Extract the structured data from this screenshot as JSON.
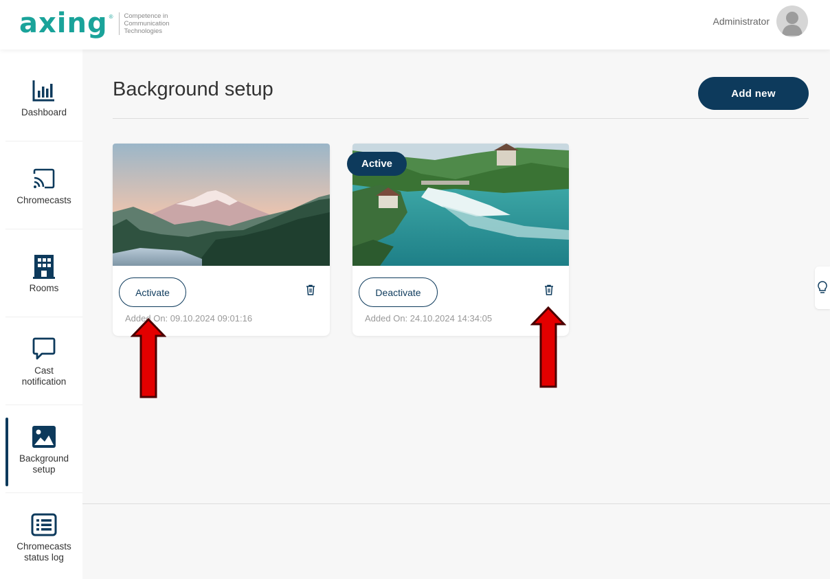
{
  "header": {
    "logo_word": "axing",
    "logo_reg": "®",
    "logo_tagline": [
      "Competence in",
      "Communication",
      "Technologies"
    ],
    "user_name": "Administrator"
  },
  "sidebar": {
    "items": [
      {
        "label": "Dashboard",
        "icon": "bar-chart-icon"
      },
      {
        "label": "Chromecasts",
        "icon": "cast-icon"
      },
      {
        "label": "Rooms",
        "icon": "building-icon"
      },
      {
        "label": "Cast notification",
        "icon": "speech-bubble-icon"
      },
      {
        "label": "Background setup",
        "icon": "image-icon",
        "active": true
      },
      {
        "label": "Chromecasts status log",
        "icon": "list-icon"
      }
    ]
  },
  "main": {
    "title": "Background setup",
    "add_button": "Add new",
    "cards": [
      {
        "button": "Activate",
        "added_on": "Added On: 09.10.2024 09:01:16",
        "image": "mountain-landscape",
        "active": false
      },
      {
        "button": "Deactivate",
        "added_on": "Added On: 24.10.2024 14:34:05",
        "image": "waterfall-landscape",
        "active": true,
        "badge": "Active"
      }
    ]
  },
  "colors": {
    "brand": "#1aa39a",
    "accent": "#0d3a5c",
    "arrow": "#e30000"
  }
}
